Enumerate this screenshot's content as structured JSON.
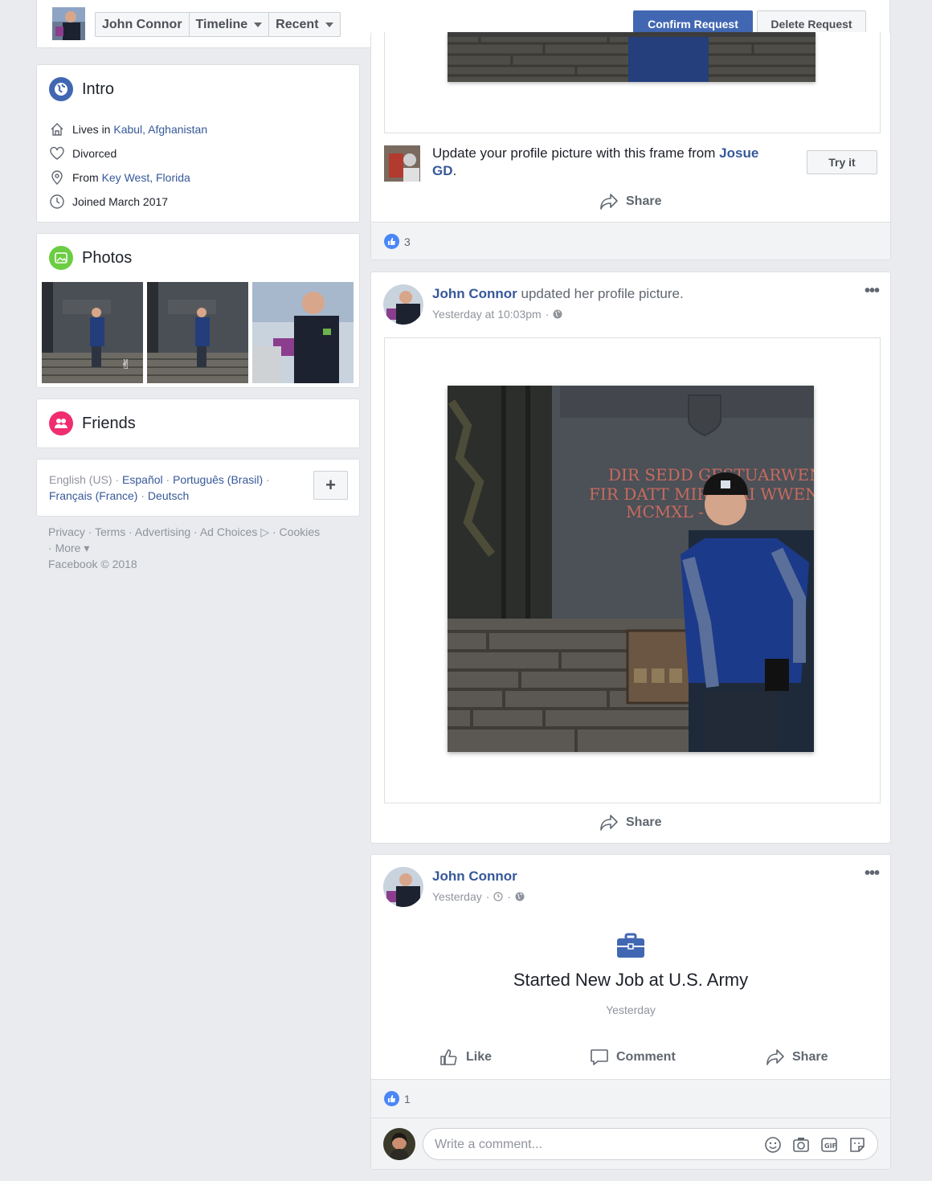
{
  "header": {
    "name": "John Connor",
    "timeline": "Timeline",
    "recent": "Recent",
    "confirm": "Confirm Request",
    "delete": "Delete Request"
  },
  "intro": {
    "title": "Intro",
    "lives_prefix": "Lives in ",
    "lives_place": "Kabul, Afghanistan",
    "status": "Divorced",
    "from_prefix": "From ",
    "from_place": "Key West, Florida",
    "joined": "Joined March 2017"
  },
  "photos": {
    "title": "Photos"
  },
  "friends": {
    "title": "Friends"
  },
  "languages": {
    "current": "English (US)",
    "options": [
      "Español",
      "Português (Brasil)",
      "Français (France)",
      "Deutsch"
    ]
  },
  "footer": {
    "privacy": "Privacy",
    "terms": "Terms",
    "advertising": "Advertising",
    "ad_choices": "Ad Choices",
    "cookies": "Cookies",
    "more": "More",
    "copyright": "Facebook © 2018"
  },
  "post1": {
    "frame_text": "Update your profile picture with this frame from ",
    "frame_author": "Josue GD",
    "try_it": "Try it",
    "share": "Share",
    "likes": "3"
  },
  "post2": {
    "name": "John Connor",
    "action": " updated her profile picture.",
    "time": "Yesterday at 10:03pm",
    "share": "Share",
    "plaque_line1": "DIR SEDD GESTUARWEN",
    "plaque_line2": "FIR DATT MIR FRAI  WWEN",
    "plaque_line3": "MCMXL - MC"
  },
  "post3": {
    "name": "John Connor",
    "time": "Yesterday",
    "headline": "Started New Job at U.S. Army",
    "subtime": "Yesterday",
    "like": "Like",
    "comment": "Comment",
    "share": "Share",
    "likes": "1",
    "comment_placeholder": "Write a comment..."
  },
  "colors": {
    "brand": "#4267b2",
    "link": "#365899",
    "like_blue": "#4a86f7"
  }
}
